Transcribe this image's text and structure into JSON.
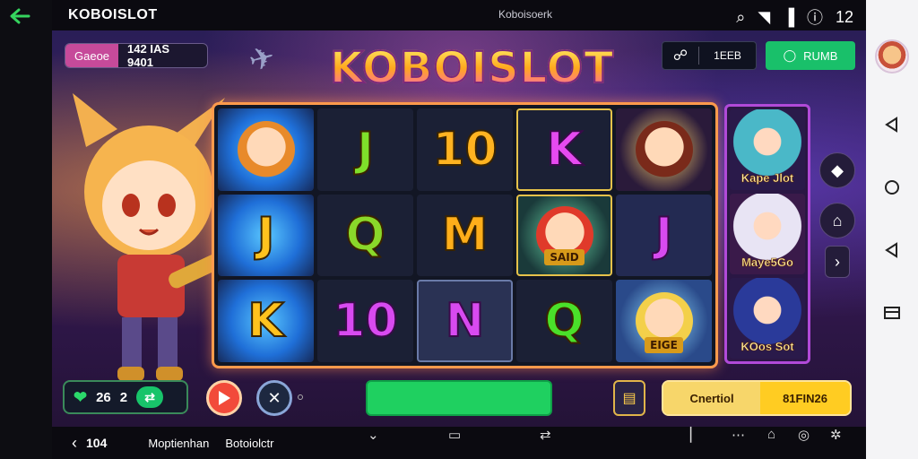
{
  "status_bar": {
    "app_title": "KOBOISLOT",
    "center_label": "Koboisoerk",
    "clock": "12"
  },
  "game": {
    "tag_label": "Gaeoe",
    "tag_value": "142 IAS 9401",
    "logo": "KOBOISLOT",
    "top_button_label": "1EEB",
    "green_button_label": "RUMB",
    "reels": [
      [
        "char",
        "J",
        "10",
        "K",
        "char"
      ],
      [
        "J",
        "Q",
        "M",
        "char-tag",
        "J"
      ],
      [
        "K",
        "10",
        "N",
        "Q",
        "char-tag2"
      ]
    ],
    "reel_tag_1": "SAID",
    "reel_tag_2": "EIGE",
    "side_cards": [
      "Kape Jlot",
      "Maye5Go",
      "KOos Sot"
    ],
    "balance_value": "26",
    "balance_bet": "2",
    "win_label": "Cnertiol",
    "win_value": "81FIN26"
  },
  "bottom_bar": {
    "count": "104",
    "text_1": "Moptienhan",
    "text_2": "Botoiolctr"
  },
  "colors": {
    "accent_green": "#1fd060",
    "frame_orange": "#ff9a4c",
    "gold": "#f1c02c"
  }
}
